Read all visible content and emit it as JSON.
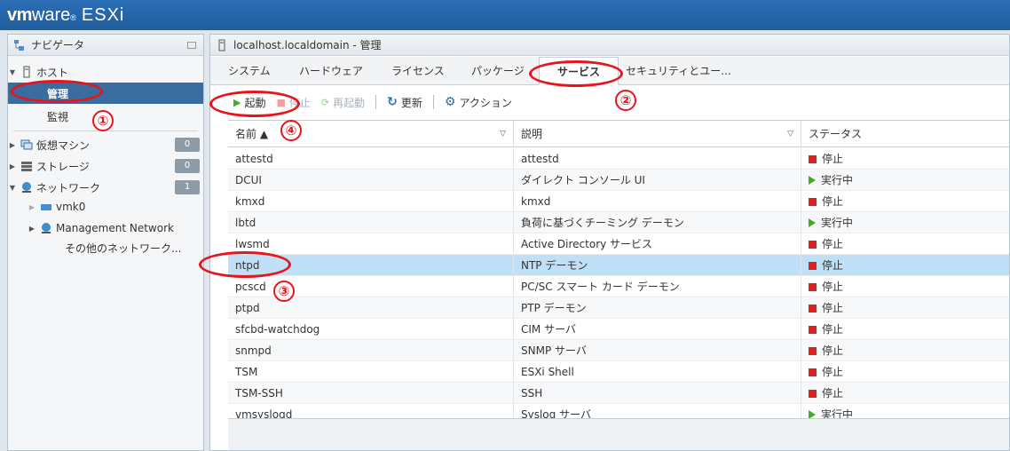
{
  "header": {
    "brand_vm": "vm",
    "brand_ware": "ware",
    "brand_tm": "®",
    "brand_product": "ESXi"
  },
  "navigator": {
    "title": "ナビゲータ",
    "host": "ホスト",
    "manage": "管理",
    "monitor": "監視",
    "vms": {
      "label": "仮想マシン",
      "count": "0"
    },
    "storage": {
      "label": "ストレージ",
      "count": "0"
    },
    "network": {
      "label": "ネットワーク",
      "count": "1"
    },
    "vmk0": "vmk0",
    "mgmt_network": "Management Network",
    "other_networks": "その他のネットワーク..."
  },
  "main": {
    "title": "localhost.localdomain - 管理",
    "tabs": [
      "システム",
      "ハードウェア",
      "ライセンス",
      "パッケージ",
      "サービス",
      "セキュリティとユー..."
    ],
    "active_tab": "サービス",
    "toolbar": {
      "start": "起動",
      "stop": "停止",
      "restart": "再起動",
      "refresh": "更新",
      "actions": "アクション"
    }
  },
  "table": {
    "columns": [
      "名前 ▲",
      "説明",
      "ステータス"
    ],
    "rows": [
      {
        "name": "attestd",
        "desc": "attestd",
        "status": "停止",
        "state": "stopped"
      },
      {
        "name": "DCUI",
        "desc": "ダイレクト コンソール UI",
        "status": "実行中",
        "state": "running"
      },
      {
        "name": "kmxd",
        "desc": "kmxd",
        "status": "停止",
        "state": "stopped"
      },
      {
        "name": "lbtd",
        "desc": "負荷に基づくチーミング デーモン",
        "status": "実行中",
        "state": "running"
      },
      {
        "name": "lwsmd",
        "desc": "Active Directory サービス",
        "status": "停止",
        "state": "stopped"
      },
      {
        "name": "ntpd",
        "desc": "NTP デーモン",
        "status": "停止",
        "state": "stopped"
      },
      {
        "name": "pcscd",
        "desc": "PC/SC スマート カード デーモン",
        "status": "停止",
        "state": "stopped"
      },
      {
        "name": "ptpd",
        "desc": "PTP デーモン",
        "status": "停止",
        "state": "stopped"
      },
      {
        "name": "sfcbd-watchdog",
        "desc": "CIM サーバ",
        "status": "停止",
        "state": "stopped"
      },
      {
        "name": "snmpd",
        "desc": "SNMP サーバ",
        "status": "停止",
        "state": "stopped"
      },
      {
        "name": "TSM",
        "desc": "ESXi Shell",
        "status": "停止",
        "state": "stopped"
      },
      {
        "name": "TSM-SSH",
        "desc": "SSH",
        "status": "停止",
        "state": "stopped"
      },
      {
        "name": "vmsyslogd",
        "desc": "Syslog サーバ",
        "status": "実行中",
        "state": "running"
      }
    ],
    "selected_row": "ntpd"
  },
  "annotations": [
    "①",
    "②",
    "③",
    "④"
  ],
  "colors": {
    "accent": "#3a6ca0",
    "annotation": "#e8141c",
    "selected_row": "#bfe0f7",
    "stopped": "#e02020",
    "running": "#3fae29"
  }
}
